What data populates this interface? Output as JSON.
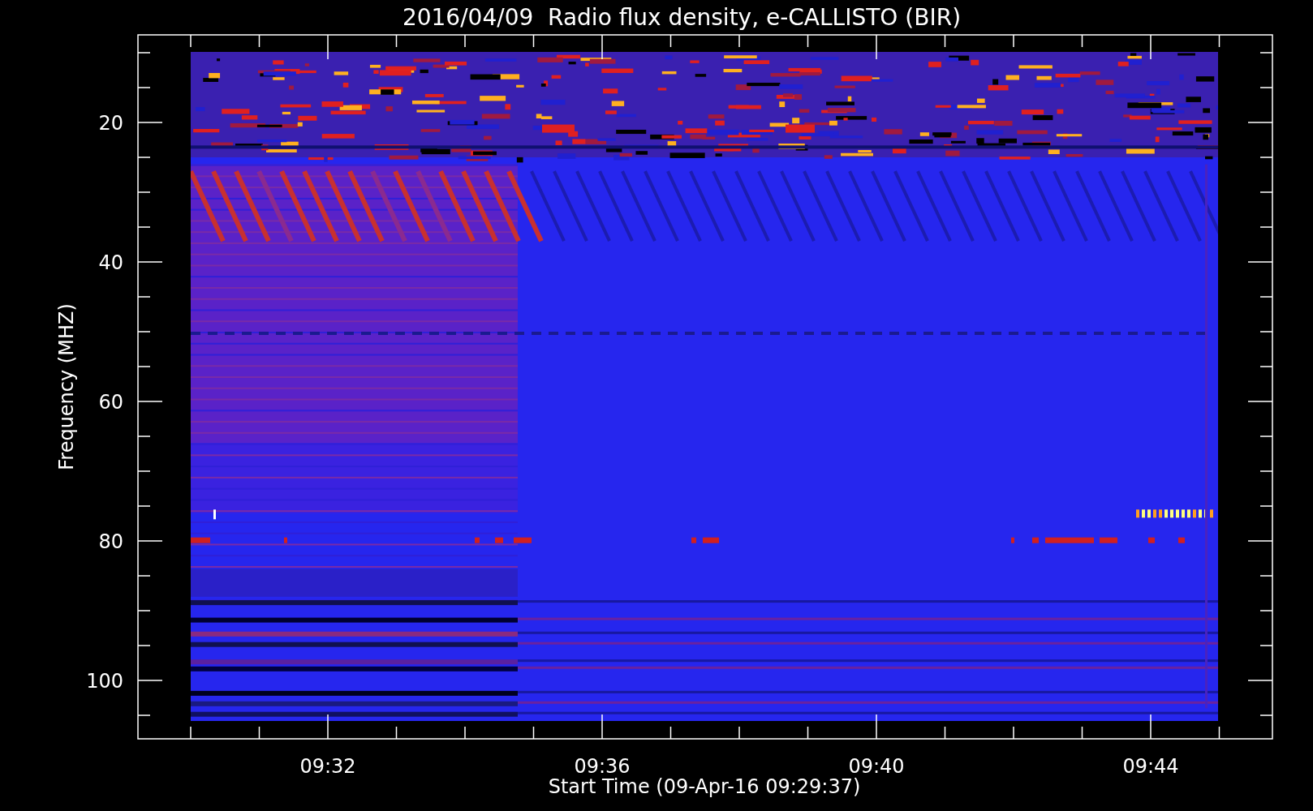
{
  "title": "2016/04/09  Radio flux density, e-CALLISTO (BIR)",
  "y_axis": {
    "label": "Frequency (MHZ)",
    "ticks": [
      "20",
      "40",
      "60",
      "80",
      "100"
    ]
  },
  "x_axis": {
    "label": "Start Time (09-Apr-16 09:29:37)",
    "ticks": [
      "09:32",
      "09:36",
      "09:40",
      "09:44"
    ]
  },
  "plot": {
    "kind": "spectrogram"
  }
}
